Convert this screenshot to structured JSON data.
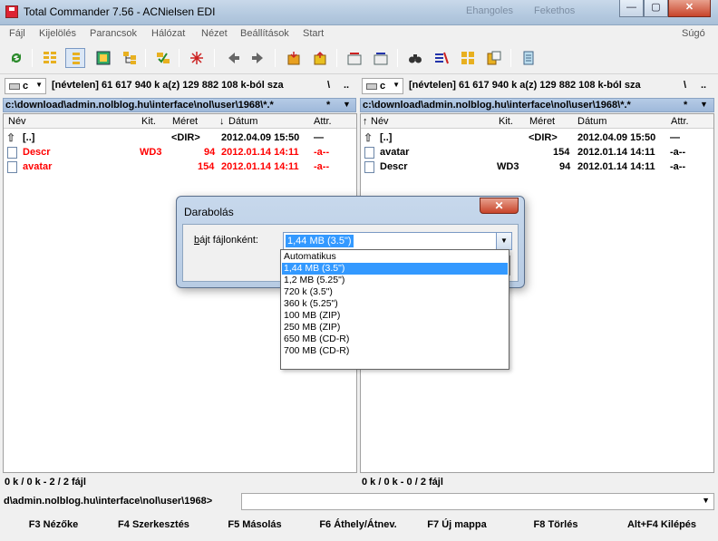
{
  "window": {
    "title": "Total Commander 7.56 - ACNielsen EDI",
    "background_tabs": [
      "Ehangoles",
      "Fekethos"
    ],
    "minimize": "—",
    "maximize": "▢",
    "close": "✕"
  },
  "menu": [
    "Fájl",
    "Kijelölés",
    "Parancsok",
    "Hálózat",
    "Nézet",
    "Beállítások",
    "Start"
  ],
  "menu_help": "Súgó",
  "toolbar_icons": [
    "refresh-icon",
    "brief-view-icon",
    "detailed-view-icon",
    "thumbnail-view-icon",
    "tree-view-icon",
    "invert-selection-icon",
    "select-all-icon",
    "back-icon",
    "forward-icon",
    "pack-icon",
    "unpack-icon",
    "ftp-connect-icon",
    "url-connect-icon",
    "find-files-icon",
    "multi-rename-icon",
    "sync-dirs-icon",
    "compare-icon",
    "notepad-icon"
  ],
  "left": {
    "drive": "c",
    "drive_info": "[névtelen]  61 617 940 k a(z) 129 882 108 k-ból sza",
    "root_btn": "\\",
    "up_btn": "..",
    "path": "c:\\download\\admin.nolblog.hu\\interface\\nol\\user\\1968\\*.*",
    "path_star": "*",
    "path_arrow": "▼",
    "columns": {
      "name": "Név",
      "ext": "Kit.",
      "size": "Méret",
      "date": "Dátum",
      "attr": "Attr."
    },
    "sort_marker": "↓",
    "files": [
      {
        "name": "[..]",
        "ext": "",
        "size": "<DIR>",
        "date": "2012.04.09 15:50",
        "attr": "—"
      },
      {
        "name": "Descr",
        "ext": "WD3",
        "size": "94",
        "date": "2012.01.14 14:11",
        "attr": "-a--"
      },
      {
        "name": "avatar",
        "ext": "",
        "size": "154",
        "date": "2012.01.14 14:11",
        "attr": "-a--"
      }
    ],
    "status": "0 k / 0 k - 2 / 2 fájl"
  },
  "right": {
    "drive": "c",
    "drive_info": "[névtelen]  61 617 940 k a(z) 129 882 108 k-ból sza",
    "root_btn": "\\",
    "up_btn": "..",
    "path": "c:\\download\\admin.nolblog.hu\\interface\\nol\\user\\1968\\*.*",
    "path_star": "*",
    "path_arrow": "▼",
    "columns": {
      "name": "Név",
      "ext": "Kit.",
      "size": "Méret",
      "date": "Dátum",
      "attr": "Attr."
    },
    "sort_marker": "↑",
    "files": [
      {
        "name": "[..]",
        "ext": "",
        "size": "<DIR>",
        "date": "2012.04.09 15:50",
        "attr": "—"
      },
      {
        "name": "avatar",
        "ext": "",
        "size": "154",
        "date": "2012.01.14 14:11",
        "attr": "-a--"
      },
      {
        "name": "Descr",
        "ext": "WD3",
        "size": "94",
        "date": "2012.01.14 14:11",
        "attr": "-a--"
      }
    ],
    "status": "0 k / 0 k - 0 / 2 fájl"
  },
  "cmdline": {
    "path": "d\\admin.nolblog.hu\\interface\\nol\\user\\1968>",
    "value": "",
    "arrow": "▼"
  },
  "fkeys": [
    "F3 Nézőke",
    "F4 Szerkesztés",
    "F5 Másolás",
    "F6 Áthely/Átnev.",
    "F7 Új mappa",
    "F8 Törlés",
    "Alt+F4 Kilépés"
  ],
  "dialog": {
    "title": "Darabolás",
    "close": "✕",
    "label_underlined": "b",
    "label_rest": "ájt fájlonként:",
    "selected": "1,44 MB (3.5\")",
    "arrow": "▼",
    "options": [
      "Automatikus",
      "1,44 MB (3.5\")",
      "1,2 MB (5.25\")",
      "720 k (3.5\")",
      "360 k (5.25\")",
      "100 MB (ZIP)",
      "250 MB (ZIP)",
      "650 MB (CD-R)",
      "700 MB (CD-R)"
    ],
    "selected_index": 1
  },
  "colors": {
    "red_file": "#ff0000",
    "path_bar": "#9fb9da",
    "selection": "#3399ff"
  }
}
